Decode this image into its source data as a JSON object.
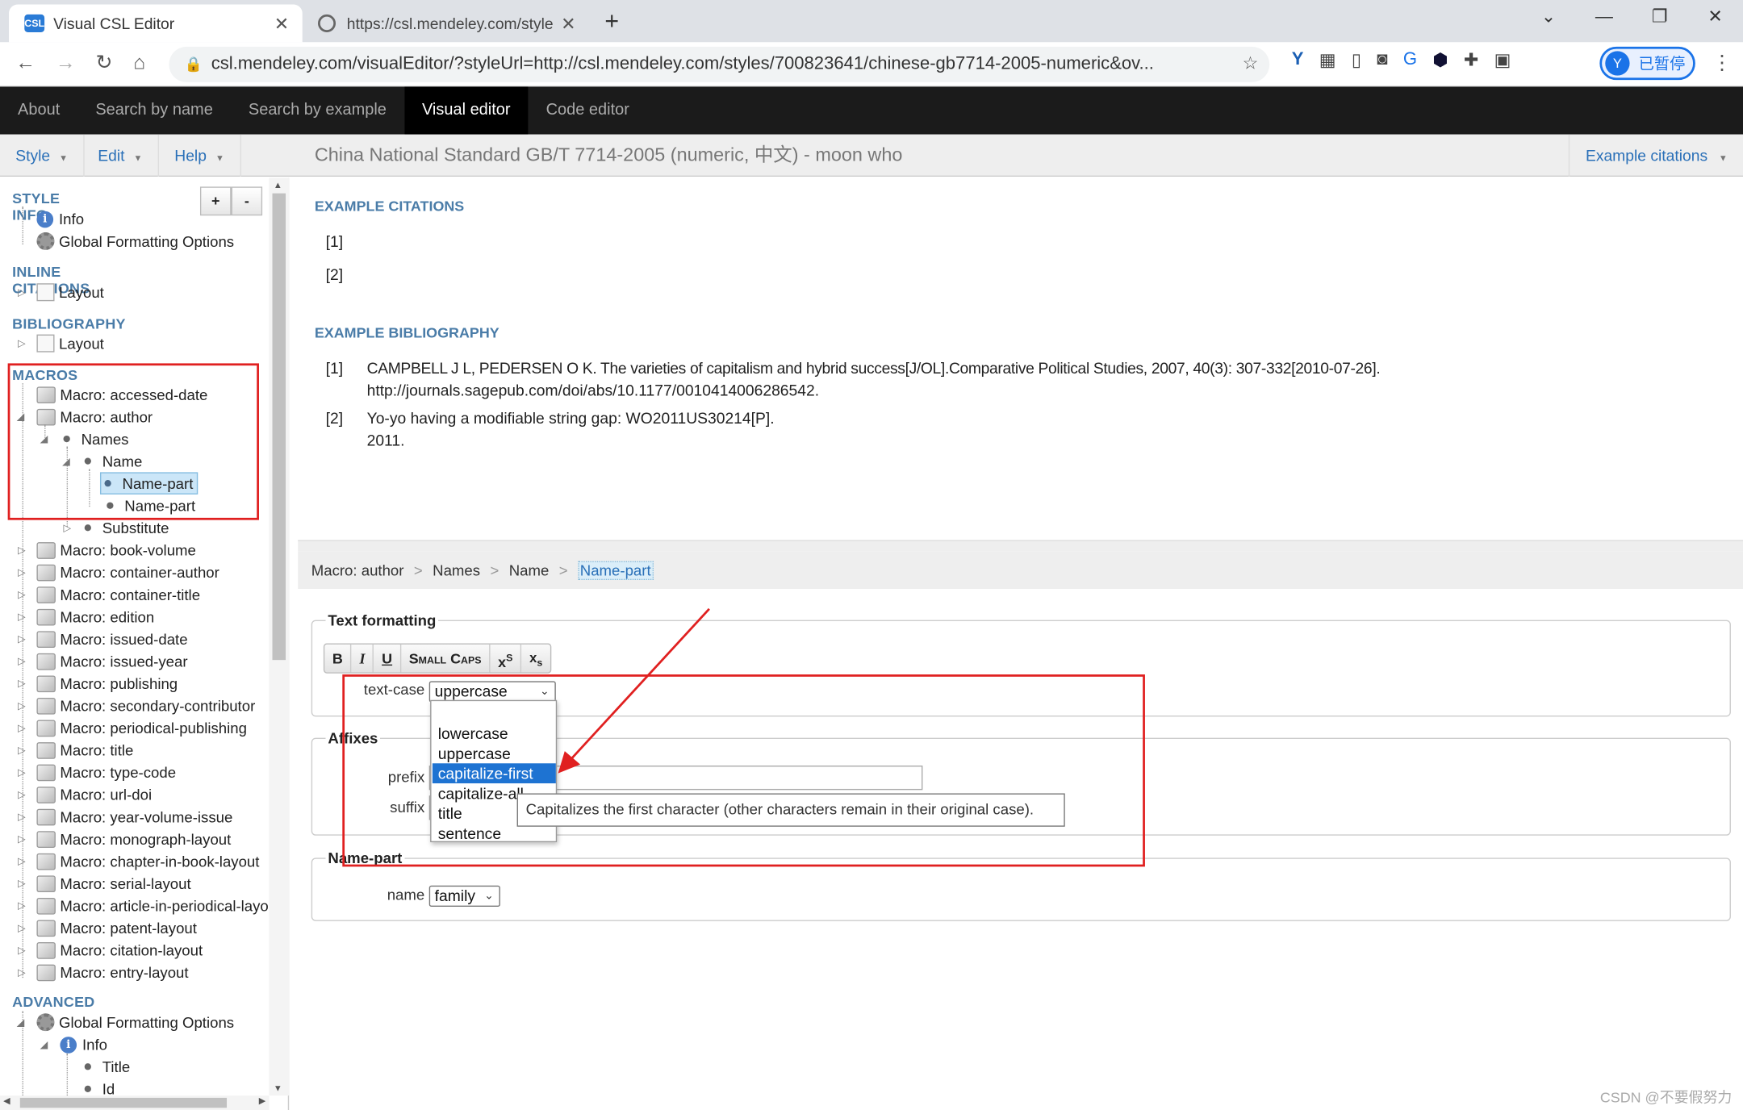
{
  "browser": {
    "tabs": [
      {
        "label": "Visual CSL Editor",
        "active": true,
        "icon": "csl-favicon"
      },
      {
        "label": "https://csl.mendeley.com/style",
        "active": false,
        "icon": "globe-icon"
      }
    ],
    "url": "csl.mendeley.com/visualEditor/?styleUrl=http://csl.mendeley.com/styles/700823641/chinese-gb7714-2005-numeric&ov...",
    "profile_initial": "Y",
    "profile_status": "已暂停",
    "favicon_text": "CSL"
  },
  "topnav": {
    "items": [
      "About",
      "Search by name",
      "Search by example",
      "Visual editor",
      "Code editor"
    ],
    "active": "Visual editor"
  },
  "toolbar": {
    "menus": [
      "Style",
      "Edit",
      "Help"
    ],
    "style_title": "China National Standard GB/T 7714-2005 (numeric, 中文) - moon who",
    "example_citations": "Example citations"
  },
  "tree": {
    "add_label": "+",
    "remove_label": "-",
    "style_info": {
      "heading": "STYLE INFO",
      "items": [
        "Info",
        "Global Formatting Options"
      ]
    },
    "inline_citations": {
      "heading": "INLINE CITATIONS",
      "items": [
        "Layout"
      ]
    },
    "bibliography": {
      "heading": "BIBLIOGRAPHY",
      "items": [
        "Layout"
      ]
    },
    "macros": {
      "heading": "MACROS",
      "expanded": [
        "Macro: accessed-date",
        "Macro: author",
        "Names",
        "Name",
        "Name-part",
        "Name-part",
        "Substitute"
      ],
      "rest": [
        "Macro: book-volume",
        "Macro: container-author",
        "Macro: container-title",
        "Macro: edition",
        "Macro: issued-date",
        "Macro: issued-year",
        "Macro: publishing",
        "Macro: secondary-contributor",
        "Macro: periodical-publishing",
        "Macro: title",
        "Macro: type-code",
        "Macro: url-doi",
        "Macro: year-volume-issue",
        "Macro: monograph-layout",
        "Macro: chapter-in-book-layout",
        "Macro: serial-layout",
        "Macro: article-in-periodical-layou",
        "Macro: patent-layout",
        "Macro: citation-layout",
        "Macro: entry-layout"
      ]
    },
    "advanced": {
      "heading": "ADVANCED",
      "items": [
        "Global Formatting Options",
        "Info",
        "Title",
        "Id"
      ]
    }
  },
  "examples": {
    "citations_heading": "EXAMPLE CITATIONS",
    "citations": [
      "[1]",
      "[2]"
    ],
    "bibliography_heading": "EXAMPLE BIBLIOGRAPHY",
    "bibliography": [
      {
        "num": "[1]",
        "line1": "CAMPBELL J L, PEDERSEN O K. The varieties of capitalism and hybrid success[J/OL].Comparative Political Studies, 2007, 40(3): 307-332[2010-07-26].",
        "line2": "http://journals.sagepub.com/doi/abs/10.1177/0010414006286542."
      },
      {
        "num": "[2]",
        "line1": "Yo-yo having a modifiable string gap: WO2011US30214[P].",
        "line2": "2011."
      }
    ]
  },
  "breadcrumb": [
    "Macro: author",
    "Names",
    "Name",
    "Name-part"
  ],
  "editor": {
    "text_formatting": {
      "legend": "Text formatting",
      "buttons": [
        "B",
        "I",
        "U",
        "Small Caps",
        "xS",
        "xs"
      ],
      "text_case_label": "text-case",
      "text_case_value": "uppercase",
      "options": [
        "",
        "lowercase",
        "uppercase",
        "capitalize-first",
        "capitalize-all",
        "title",
        "sentence"
      ],
      "highlighted": "capitalize-first",
      "tooltip": "Capitalizes the first character (other characters remain in their original case)."
    },
    "affixes": {
      "legend": "Affixes",
      "prefix_label": "prefix",
      "suffix_label": "suffix",
      "prefix_value": "",
      "suffix_value": ""
    },
    "name_part": {
      "legend": "Name-part",
      "name_label": "name",
      "name_value": "family"
    }
  },
  "watermark": "CSDN @不要假努力",
  "colors": {
    "accent": "#2a70b8",
    "annotation": "#e02020",
    "nav_bg": "#1b1b1b",
    "highlight": "#1e73d2"
  }
}
